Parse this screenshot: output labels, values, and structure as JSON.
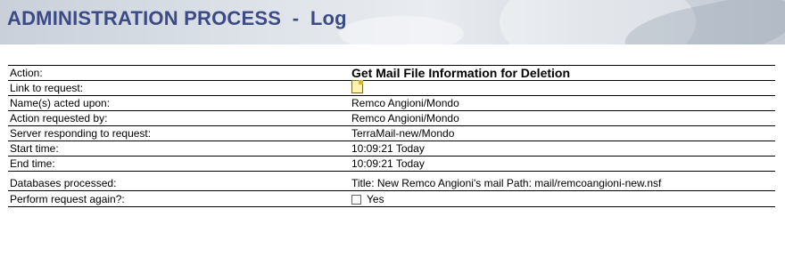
{
  "header": {
    "title": "ADMINISTRATION PROCESS  -  Log"
  },
  "log": {
    "action_label": "Action:",
    "action_value": "Get Mail File Information for Deletion",
    "link_label": "Link to request:",
    "link_icon": "document-link-icon",
    "names_label": "Name(s) acted upon:",
    "names_value": "Remco Angioni/Mondo",
    "requested_label": "Action requested by:",
    "requested_value": "Remco Angioni/Mondo",
    "server_label": "Server responding to request:",
    "server_value": "TerraMail-new/Mondo",
    "start_label": "Start time:",
    "start_value": "10:09:21 Today",
    "end_label": "End time:",
    "end_value": "10:09:21 Today",
    "db_label": "Databases processed:",
    "db_value": "Title: New Remco Angioni's mail Path: mail/remcoangioni-new.nsf",
    "perform_label": "Perform request again?:",
    "perform_option": "Yes",
    "perform_checked": false
  },
  "colors": {
    "title": "#3c4a86"
  }
}
